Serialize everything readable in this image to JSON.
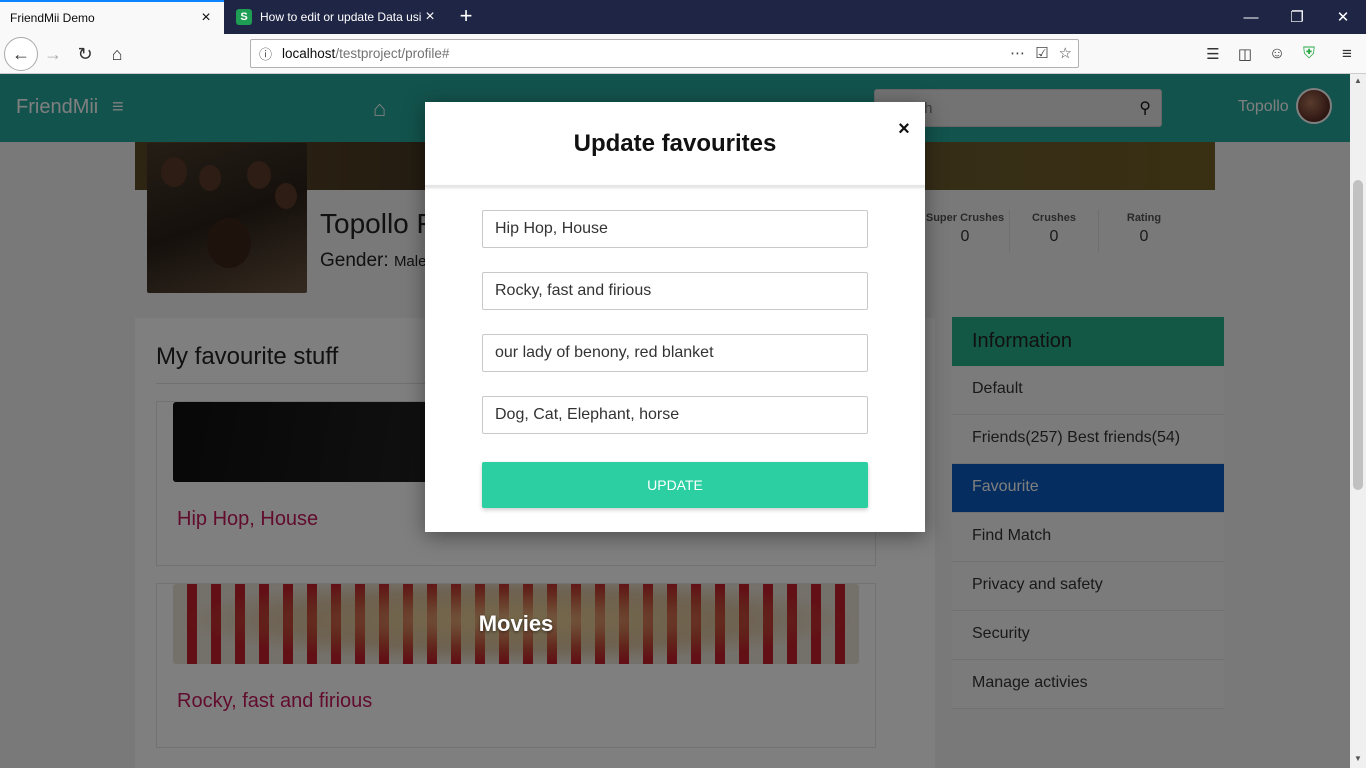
{
  "browser": {
    "tabs": [
      {
        "title": "FriendMii Demo",
        "active": true
      },
      {
        "title": "How to edit or update Data usi",
        "active": false,
        "favicon": "S"
      }
    ],
    "url_host": "localhost",
    "url_path": "/testproject/profile#"
  },
  "app": {
    "brand": "FriendMii",
    "search_placeholder": "Search",
    "username": "Topollo",
    "accent_color": "#26a69a"
  },
  "profile": {
    "name": "Topollo F",
    "gender_label": "Gender:",
    "gender_value": "Male",
    "stats": [
      {
        "label": "Super Crushes",
        "value": "0"
      },
      {
        "label": "Crushes",
        "value": "0"
      },
      {
        "label": "Rating",
        "value": "0"
      }
    ]
  },
  "favourites": {
    "heading": "My favourite stuff",
    "cards": [
      {
        "image_title": "",
        "value": "Hip Hop, House"
      },
      {
        "image_title": "Movies",
        "value": "Rocky, fast and firious"
      }
    ]
  },
  "info_panel": {
    "heading": "Information",
    "items": [
      {
        "label": "Default",
        "active": false
      },
      {
        "label": "Friends(257) Best friends(54)",
        "active": false
      },
      {
        "label": "Favourite",
        "active": true
      },
      {
        "label": "Find Match",
        "active": false
      },
      {
        "label": "Privacy and safety",
        "active": false
      },
      {
        "label": "Security",
        "active": false
      },
      {
        "label": "Manage activies",
        "active": false
      }
    ]
  },
  "modal": {
    "title": "Update favourites",
    "close_label": "×",
    "fields": [
      {
        "value": "Hip Hop, House"
      },
      {
        "value": "Rocky, fast and firious"
      },
      {
        "value": "our lady of benony, red blanket"
      },
      {
        "value": "Dog, Cat, Elephant, horse"
      }
    ],
    "update_label": "UPDATE",
    "button_color": "#2bcfa1"
  }
}
